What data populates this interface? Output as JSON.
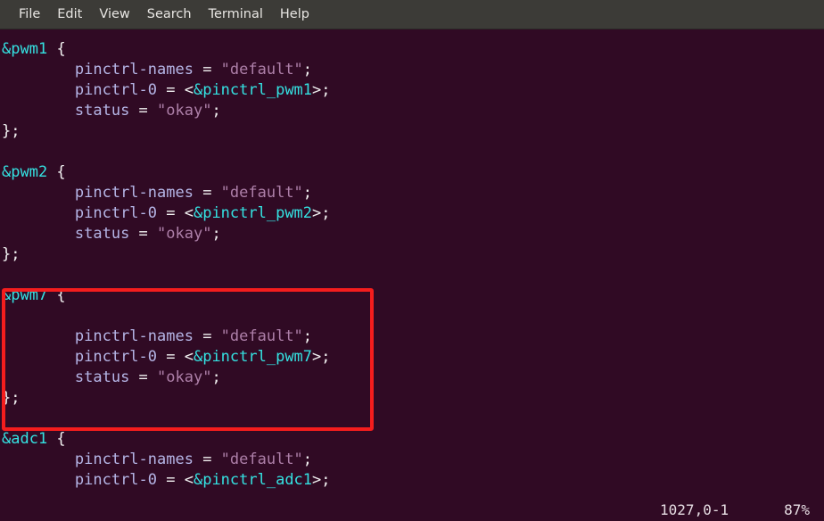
{
  "menubar": {
    "items": [
      {
        "label": "File"
      },
      {
        "label": "Edit"
      },
      {
        "label": "View"
      },
      {
        "label": "Search"
      },
      {
        "label": "Terminal"
      },
      {
        "label": "Help"
      }
    ]
  },
  "terminal": {
    "background_color": "#300a24",
    "menubar_color": "#3c3b37",
    "colors": {
      "node_label": "#34e2e2",
      "punctuation": "#f2f2f2",
      "property": "#b5b5e6",
      "string": "#ad7fa8",
      "annotation": "#f41d1d"
    },
    "lines": [
      {
        "text": "&pwm1 {",
        "segments": [
          {
            "t": "&pwm1",
            "c": "node"
          },
          {
            "t": " ",
            "c": "punct"
          },
          {
            "t": "{",
            "c": "punct"
          }
        ]
      },
      {
        "text": "        pinctrl-names = \"default\";",
        "segments": [
          {
            "t": "        ",
            "c": "punct"
          },
          {
            "t": "pinctrl-names",
            "c": "prop"
          },
          {
            "t": " = ",
            "c": "punct"
          },
          {
            "t": "\"default\"",
            "c": "str"
          },
          {
            "t": ";",
            "c": "punct"
          }
        ]
      },
      {
        "text": "        pinctrl-0 = <&pinctrl_pwm1>;",
        "segments": [
          {
            "t": "        ",
            "c": "punct"
          },
          {
            "t": "pinctrl-0",
            "c": "prop"
          },
          {
            "t": " = <",
            "c": "punct"
          },
          {
            "t": "&pinctrl_pwm1",
            "c": "node"
          },
          {
            "t": ">;",
            "c": "punct"
          }
        ]
      },
      {
        "text": "        status = \"okay\";",
        "segments": [
          {
            "t": "        ",
            "c": "punct"
          },
          {
            "t": "status",
            "c": "prop"
          },
          {
            "t": " = ",
            "c": "punct"
          },
          {
            "t": "\"okay\"",
            "c": "str"
          },
          {
            "t": ";",
            "c": "punct"
          }
        ]
      },
      {
        "text": "};",
        "segments": [
          {
            "t": "};",
            "c": "punct"
          }
        ]
      },
      {
        "text": "",
        "segments": []
      },
      {
        "text": "&pwm2 {",
        "segments": [
          {
            "t": "&pwm2",
            "c": "node"
          },
          {
            "t": " {",
            "c": "punct"
          }
        ]
      },
      {
        "text": "        pinctrl-names = \"default\";",
        "segments": [
          {
            "t": "        ",
            "c": "punct"
          },
          {
            "t": "pinctrl-names",
            "c": "prop"
          },
          {
            "t": " = ",
            "c": "punct"
          },
          {
            "t": "\"default\"",
            "c": "str"
          },
          {
            "t": ";",
            "c": "punct"
          }
        ]
      },
      {
        "text": "        pinctrl-0 = <&pinctrl_pwm2>;",
        "segments": [
          {
            "t": "        ",
            "c": "punct"
          },
          {
            "t": "pinctrl-0",
            "c": "prop"
          },
          {
            "t": " = <",
            "c": "punct"
          },
          {
            "t": "&pinctrl_pwm2",
            "c": "node"
          },
          {
            "t": ">;",
            "c": "punct"
          }
        ]
      },
      {
        "text": "        status = \"okay\";",
        "segments": [
          {
            "t": "        ",
            "c": "punct"
          },
          {
            "t": "status",
            "c": "prop"
          },
          {
            "t": " = ",
            "c": "punct"
          },
          {
            "t": "\"okay\"",
            "c": "str"
          },
          {
            "t": ";",
            "c": "punct"
          }
        ]
      },
      {
        "text": "};",
        "segments": [
          {
            "t": "};",
            "c": "punct"
          }
        ]
      },
      {
        "text": "",
        "segments": []
      },
      {
        "text": "&pwm7 {",
        "segments": [
          {
            "t": "&pwm7",
            "c": "node"
          },
          {
            "t": " {",
            "c": "punct"
          }
        ]
      },
      {
        "text": "",
        "segments": []
      },
      {
        "text": "        pinctrl-names = \"default\";",
        "segments": [
          {
            "t": "        ",
            "c": "punct"
          },
          {
            "t": "pinctrl-names",
            "c": "prop"
          },
          {
            "t": " = ",
            "c": "punct"
          },
          {
            "t": "\"default\"",
            "c": "str"
          },
          {
            "t": ";",
            "c": "punct"
          }
        ]
      },
      {
        "text": "        pinctrl-0 = <&pinctrl_pwm7>;",
        "segments": [
          {
            "t": "        ",
            "c": "punct"
          },
          {
            "t": "pinctrl-0",
            "c": "prop"
          },
          {
            "t": " = <",
            "c": "punct"
          },
          {
            "t": "&pinctrl_pwm7",
            "c": "node"
          },
          {
            "t": ">;",
            "c": "punct"
          }
        ]
      },
      {
        "text": "        status = \"okay\";",
        "segments": [
          {
            "t": "        ",
            "c": "punct"
          },
          {
            "t": "status",
            "c": "prop"
          },
          {
            "t": " = ",
            "c": "punct"
          },
          {
            "t": "\"okay\"",
            "c": "str"
          },
          {
            "t": ";",
            "c": "punct"
          }
        ]
      },
      {
        "text": "};",
        "segments": [
          {
            "t": "};",
            "c": "punct"
          }
        ]
      },
      {
        "text": "",
        "segments": []
      },
      {
        "text": "&adc1 {",
        "segments": [
          {
            "t": "&adc1",
            "c": "node"
          },
          {
            "t": " {",
            "c": "punct"
          }
        ]
      },
      {
        "text": "        pinctrl-names = \"default\";",
        "segments": [
          {
            "t": "        ",
            "c": "punct"
          },
          {
            "t": "pinctrl-names",
            "c": "prop"
          },
          {
            "t": " = ",
            "c": "punct"
          },
          {
            "t": "\"default\"",
            "c": "str"
          },
          {
            "t": ";",
            "c": "punct"
          }
        ]
      },
      {
        "text": "        pinctrl-0 = <&pinctrl_adc1>;",
        "segments": [
          {
            "t": "        ",
            "c": "punct"
          },
          {
            "t": "pinctrl-0",
            "c": "prop"
          },
          {
            "t": " = <",
            "c": "punct"
          },
          {
            "t": "&pinctrl_adc1",
            "c": "node"
          },
          {
            "t": ">;",
            "c": "punct"
          }
        ]
      }
    ]
  },
  "annotation": {
    "shape": "rectangle",
    "color": "#f41d1d",
    "target_block": "&pwm7"
  },
  "statusbar": {
    "position": "1027,0-1",
    "percent": "87%"
  }
}
